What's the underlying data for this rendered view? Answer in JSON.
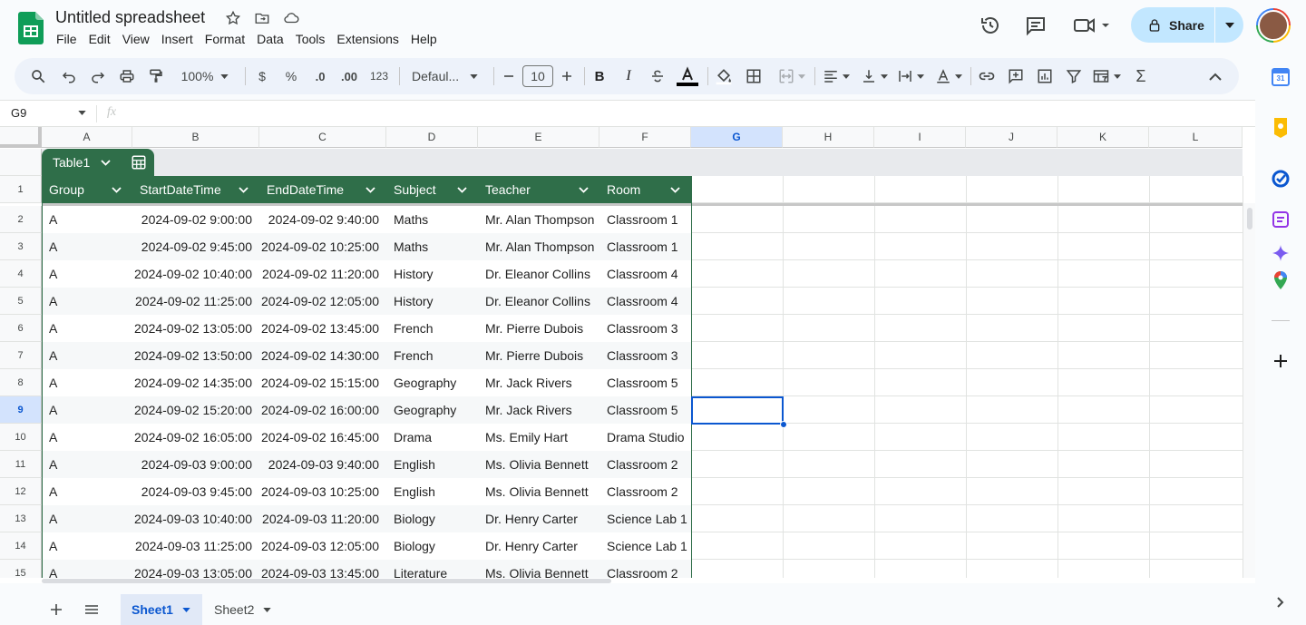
{
  "doc": {
    "title": "Untitled spreadsheet"
  },
  "menu": [
    "File",
    "Edit",
    "View",
    "Insert",
    "Format",
    "Data",
    "Tools",
    "Extensions",
    "Help"
  ],
  "share": {
    "label": "Share"
  },
  "toolbar": {
    "zoom": "100%",
    "currency": "$",
    "percent": "%",
    "dec_decrease": ".0",
    "dec_increase": ".00",
    "number_format": "123",
    "font": "Defaul...",
    "font_size": "10",
    "bold": "B",
    "italic": "I",
    "sum": "Σ"
  },
  "formula_bar": {
    "name_box": "G9",
    "fx": "fx"
  },
  "columns": [
    "A",
    "B",
    "C",
    "D",
    "E",
    "F",
    "G",
    "H",
    "I",
    "J",
    "K",
    "L"
  ],
  "selected_column": "G",
  "selected_row": "9",
  "table": {
    "name": "Table1",
    "headers": [
      "Group",
      "StartDateTime",
      "EndDateTime",
      "Subject",
      "Teacher",
      "Room"
    ],
    "rows": [
      [
        "A",
        "2024-09-02 9:00:00",
        "2024-09-02 9:40:00",
        "Maths",
        "Mr. Alan Thompson",
        "Classroom 1"
      ],
      [
        "A",
        "2024-09-02 9:45:00",
        "2024-09-02 10:25:00",
        "Maths",
        "Mr. Alan Thompson",
        "Classroom 1"
      ],
      [
        "A",
        "2024-09-02 10:40:00",
        "2024-09-02 11:20:00",
        "History",
        "Dr. Eleanor Collins",
        "Classroom 4"
      ],
      [
        "A",
        "2024-09-02 11:25:00",
        "2024-09-02 12:05:00",
        "History",
        "Dr. Eleanor Collins",
        "Classroom 4"
      ],
      [
        "A",
        "2024-09-02 13:05:00",
        "2024-09-02 13:45:00",
        "French",
        "Mr. Pierre Dubois",
        "Classroom 3"
      ],
      [
        "A",
        "2024-09-02 13:50:00",
        "2024-09-02 14:30:00",
        "French",
        "Mr. Pierre Dubois",
        "Classroom 3"
      ],
      [
        "A",
        "2024-09-02 14:35:00",
        "2024-09-02 15:15:00",
        "Geography",
        "Mr. Jack Rivers",
        "Classroom 5"
      ],
      [
        "A",
        "2024-09-02 15:20:00",
        "2024-09-02 16:00:00",
        "Geography",
        "Mr. Jack Rivers",
        "Classroom 5"
      ],
      [
        "A",
        "2024-09-02 16:05:00",
        "2024-09-02 16:45:00",
        "Drama",
        "Ms. Emily Hart",
        "Drama Studio"
      ],
      [
        "A",
        "2024-09-03 9:00:00",
        "2024-09-03 9:40:00",
        "English",
        "Ms. Olivia Bennett",
        "Classroom 2"
      ],
      [
        "A",
        "2024-09-03 9:45:00",
        "2024-09-03 10:25:00",
        "English",
        "Ms. Olivia Bennett",
        "Classroom 2"
      ],
      [
        "A",
        "2024-09-03 10:40:00",
        "2024-09-03 11:20:00",
        "Biology",
        "Dr. Henry Carter",
        "Science Lab 1"
      ],
      [
        "A",
        "2024-09-03 11:25:00",
        "2024-09-03 12:05:00",
        "Biology",
        "Dr. Henry Carter",
        "Science Lab 1"
      ],
      [
        "A",
        "2024-09-03 13:05:00",
        "2024-09-03 13:45:00",
        "Literature",
        "Ms. Olivia Bennett",
        "Classroom 2"
      ]
    ]
  },
  "row_numbers": [
    "1",
    "2",
    "3",
    "4",
    "5",
    "6",
    "7",
    "8",
    "9",
    "10",
    "11",
    "12",
    "13",
    "14",
    "15"
  ],
  "sheets": [
    {
      "name": "Sheet1",
      "active": true
    },
    {
      "name": "Sheet2",
      "active": false
    }
  ],
  "side_panel": {
    "calendar_day": "31"
  },
  "colors": {
    "accent": "#0b57d0",
    "table_green": "#2f6e49",
    "share_bg": "#c2e7ff",
    "toolbar_bg": "#edf2fa"
  }
}
